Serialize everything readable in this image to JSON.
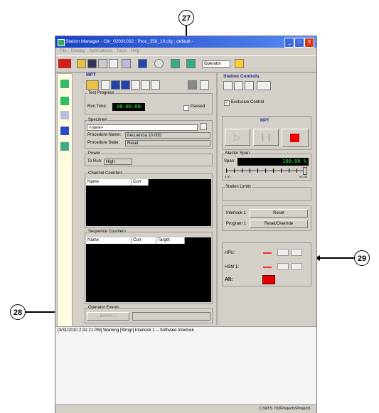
{
  "window": {
    "title": "Station Manager - Ctlr_02031032 : Proc_358_10.cfg : default -",
    "minimize": "_",
    "maximize": "□",
    "close": "X"
  },
  "menu": [
    "File",
    "Display",
    "Applications",
    "Tools",
    "Help"
  ],
  "toolbar": {
    "role_select": "Operator"
  },
  "mpt_panel": {
    "title": "MPT",
    "test_progress": {
      "label": "Test Progress",
      "run_time_label": "Run Time:",
      "run_time_value": "00:00:00",
      "paused_label": "Paused"
    },
    "specimen": {
      "label": "Specimen",
      "specimen_value": "<none>",
      "procedure_name_label": "Procedure Name:",
      "procedure_name_value": "frecuencia 10.000",
      "procedure_state_label": "Procedure State:",
      "procedure_state_value": "Reset"
    },
    "power": {
      "label": "Power",
      "to_run_label": "To Run:",
      "to_run_value": "High"
    },
    "channel_counters": {
      "label": "Channel Counters",
      "columns": [
        "Name",
        "Curr"
      ]
    },
    "sequence_counters": {
      "label": "Sequence Counters",
      "columns": [
        "Name",
        "Curr",
        "Target"
      ]
    },
    "operator_events": {
      "label": "Operator Events",
      "button_label": "Button 1"
    }
  },
  "station_controls": {
    "title": "Station Controls",
    "exclusive_control_label": "Exclusive Control",
    "mpt_label": "MPT",
    "master_span": {
      "label": "Master Span",
      "span_label": "Span:",
      "span_value": "100.00",
      "span_unit": "%",
      "slider_min": "0.00",
      "slider_max": "100.00"
    },
    "station_limits_label": "Station Limits",
    "interlock_label": "Interlock 1",
    "reset_button": "Reset",
    "program_label": "Program 1",
    "reset_override_button": "Reset/Override",
    "hpu_label": "HPU:",
    "hsm_label": "HSM 1:",
    "all_label": "All:"
  },
  "log": {
    "message": "[3/31/2010 2:31:21 PM] Warning [Stmgr] Interlock 1 -- Software Interlock"
  },
  "status_bar": {
    "path": "C:\\MTS 793\\Projects\\Project1"
  },
  "callouts": {
    "c27": "27",
    "c28": "28",
    "c29": "29"
  }
}
